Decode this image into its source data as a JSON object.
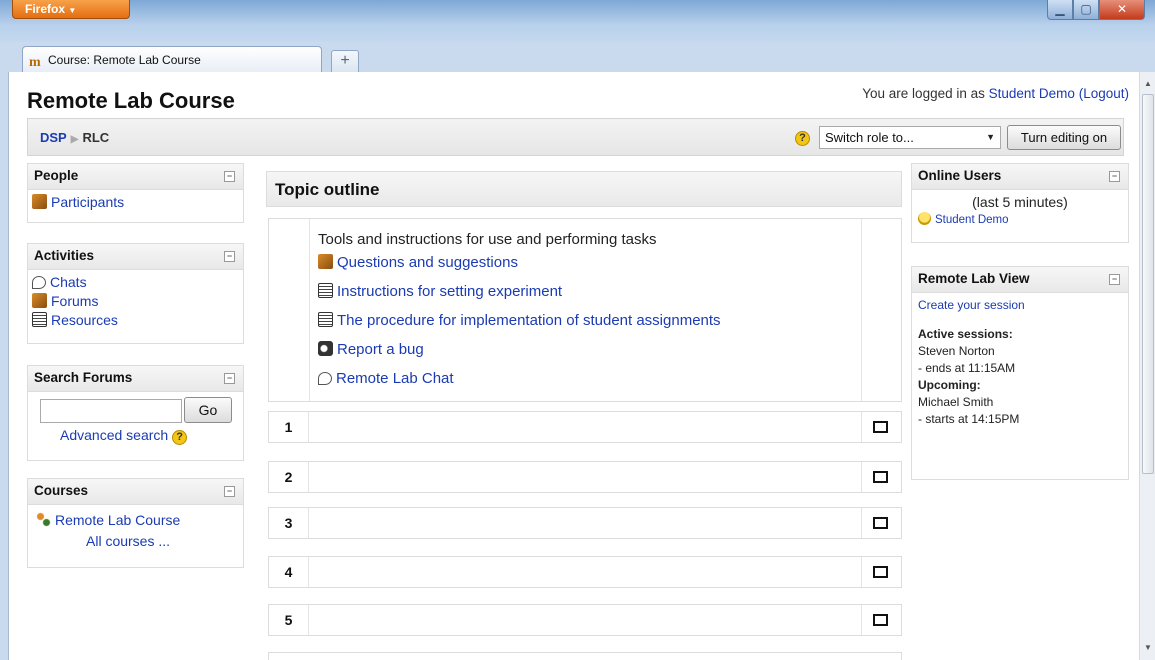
{
  "window": {
    "app_button": "Firefox",
    "tab_title": "Course: Remote Lab Course",
    "new_tab": "+"
  },
  "header": {
    "site_title": "Remote Lab Course",
    "login_prefix": "You are logged in as ",
    "user_name": "Student Demo",
    "logout": "(Logout)"
  },
  "navbar": {
    "crumb_home": "DSP",
    "crumb_current": "RLC",
    "switch_role": "Switch role to...",
    "edit_button": "Turn editing on"
  },
  "left": {
    "people": {
      "title": "People",
      "items": [
        "Participants"
      ]
    },
    "activities": {
      "title": "Activities",
      "items": [
        "Chats",
        "Forums",
        "Resources"
      ]
    },
    "search": {
      "title": "Search Forums",
      "go": "Go",
      "advanced": "Advanced search",
      "value": ""
    },
    "courses": {
      "title": "Courses",
      "items": [
        "Remote Lab Course"
      ],
      "all": "All courses ..."
    }
  },
  "main": {
    "title": "Topic outline",
    "summary": "Tools and instructions for use and performing tasks",
    "items": [
      {
        "label": "Questions and suggestions",
        "icon": "people-icon"
      },
      {
        "label": "Instructions for setting experiment",
        "icon": "document-icon"
      },
      {
        "label": "The procedure for implementation of student assignments",
        "icon": "document-icon"
      },
      {
        "label": "Report a bug",
        "icon": "bug-icon"
      },
      {
        "label": "Remote Lab Chat",
        "icon": "chat-icon"
      }
    ],
    "sections": [
      "1",
      "2",
      "3",
      "4",
      "5"
    ]
  },
  "right": {
    "online": {
      "title": "Online Users",
      "period": "(last 5 minutes)",
      "users": [
        "Student Demo"
      ]
    },
    "lab": {
      "title": "Remote Lab View",
      "create": "Create your session",
      "active_label": "Active sessions:",
      "active_name": "Steven Norton",
      "active_time": "- ends at 11:15AM",
      "upcoming_label": "Upcoming:",
      "upcoming_name": "Michael Smith",
      "upcoming_time": "- starts at 14:15PM"
    }
  }
}
